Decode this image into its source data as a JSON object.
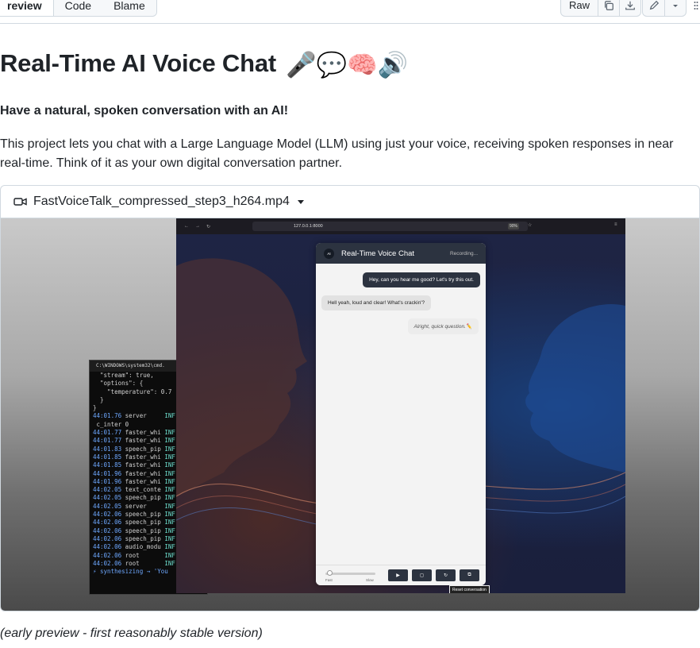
{
  "toolbar": {
    "tabs": [
      "review",
      "Code",
      "Blame"
    ],
    "raw_label": "Raw",
    "icons": [
      "copy-icon",
      "download-icon",
      "pencil-icon",
      "chevron-down-icon",
      "kebab-icon"
    ]
  },
  "readme": {
    "title": "Real-Time AI Voice Chat",
    "title_emoji": "🎤💬🧠🔊",
    "tagline": "Have a natural, spoken conversation with an AI!",
    "description": "This project lets you chat with a Large Language Model (LLM) using just your voice, receiving spoken responses in near real-time. Think of it as your own digital conversation partner.",
    "caption": "(early preview - first reasonably stable version)"
  },
  "video": {
    "filename": "FastVoiceTalk_compressed_step3_h264.mp4",
    "terminal": {
      "title": "C:\\WINDOWS\\system32\\cmd.",
      "json_lines": [
        "  \"stream\": true,",
        "  \"options\": {",
        "    \"temperature\": 0.7",
        "  }",
        "}"
      ],
      "log_lines": [
        {
          "ts": "44:01.76",
          "src": "server    ",
          "lvl": "INF"
        },
        {
          "ts": "",
          "src": "c_inter 0",
          "lvl": ""
        },
        {
          "ts": "44:01.77",
          "src": "faster_whi",
          "lvl": "INF"
        },
        {
          "ts": "44:01.77",
          "src": "faster_whi",
          "lvl": "INF"
        },
        {
          "ts": "44:01.83",
          "src": "speech_pip",
          "lvl": "INF"
        },
        {
          "ts": "44:01.85",
          "src": "faster_whi",
          "lvl": "INF"
        },
        {
          "ts": "44:01.85",
          "src": "faster_whi",
          "lvl": "INF"
        },
        {
          "ts": "44:01.96",
          "src": "faster_whi",
          "lvl": "INF"
        },
        {
          "ts": "44:01.96",
          "src": "faster_whi",
          "lvl": "INF"
        },
        {
          "ts": "44:02.05",
          "src": "text_conte",
          "lvl": "INF"
        },
        {
          "ts": "44:02.05",
          "src": "speech_pip",
          "lvl": "INF"
        },
        {
          "ts": "44:02.05",
          "src": "server    ",
          "lvl": "INF"
        },
        {
          "ts": "44:02.06",
          "src": "speech_pip",
          "lvl": "INF"
        },
        {
          "ts": "44:02.06",
          "src": "speech_pip",
          "lvl": "INF"
        },
        {
          "ts": "44:02.06",
          "src": "speech_pip",
          "lvl": "INF"
        },
        {
          "ts": "44:02.06",
          "src": "speech_pip",
          "lvl": "INF"
        },
        {
          "ts": "44:02.06",
          "src": "audio_modu",
          "lvl": "INF"
        },
        {
          "ts": "44:02.06",
          "src": "root      ",
          "lvl": "INF"
        },
        {
          "ts": "44:02.06",
          "src": "root      ",
          "lvl": "INF"
        }
      ],
      "last_line": "⚡ synthesizing → 'You"
    },
    "browser": {
      "url": "127.0.0.1:8000",
      "zoom": "90%"
    },
    "chat": {
      "logo_text": "AI",
      "title": "Real-Time Voice Chat",
      "status": "Recording...",
      "messages": [
        {
          "role": "user",
          "text": "Hey, can you hear me good? Let's try this out."
        },
        {
          "role": "ai",
          "text": "Hell yeah, loud and clear! What's crackin'?"
        },
        {
          "role": "typing",
          "text": "Alright, quick question.✏️"
        }
      ],
      "slider_left": "Fast",
      "slider_right": "Slow",
      "tooltip": "Reset conversation"
    }
  }
}
